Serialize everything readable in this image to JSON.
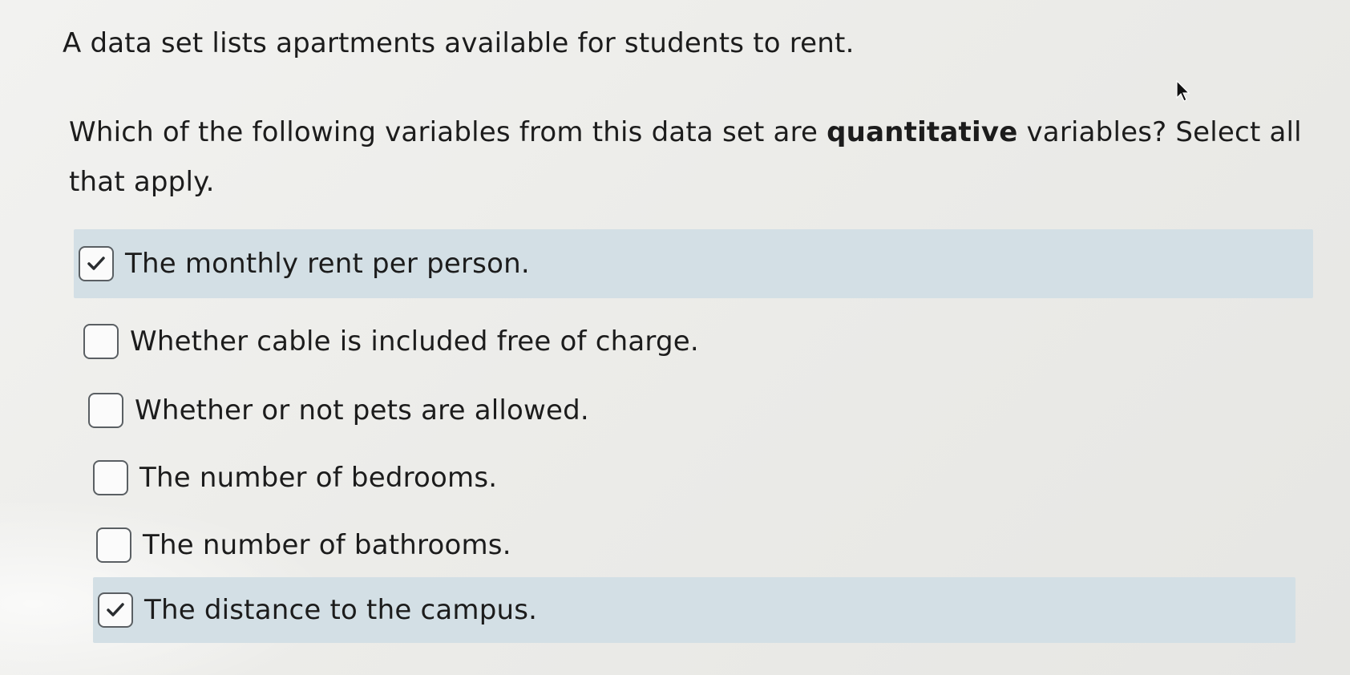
{
  "question": {
    "intro": "A data set lists apartments available for students to rent.",
    "prompt_before": "Which of the following variables from this data set are ",
    "prompt_bold": "quantitative",
    "prompt_after": " variables? Select all that apply."
  },
  "options": [
    {
      "label": "The monthly rent per person.",
      "checked": true
    },
    {
      "label": "Whether cable is included free of charge.",
      "checked": false
    },
    {
      "label": "Whether or not pets are allowed.",
      "checked": false
    },
    {
      "label": "The number of bedrooms.",
      "checked": false
    },
    {
      "label": "The number of bathrooms.",
      "checked": false
    },
    {
      "label": "The distance to the campus.",
      "checked": true
    }
  ],
  "colors": {
    "selected_background": "#d3dfe5",
    "checkbox_border": "#5a5f63",
    "text": "#1c1c1c"
  },
  "icons": {
    "checkmark": "check-icon",
    "pointer": "mouse-pointer-icon"
  }
}
